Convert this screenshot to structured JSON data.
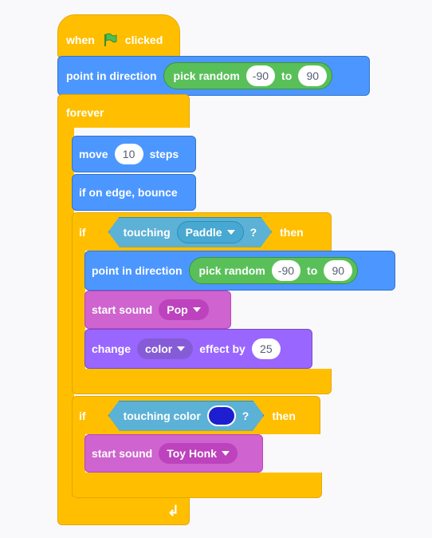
{
  "colors": {
    "control": "#ffbf00",
    "motion": "#4c97ff",
    "operators": "#59c059",
    "sensing": "#5cb1d6",
    "sound": "#cf63cf",
    "looks": "#9966ff",
    "touch_color_swatch": "#1d1ecf",
    "workspace": "#f9f9fb"
  },
  "hat": {
    "when": "when",
    "clicked": "clicked",
    "icon": "green-flag-icon"
  },
  "point_direction_1": {
    "label": "point in direction",
    "random": "pick random",
    "from": "-90",
    "to_label": "to",
    "to": "90"
  },
  "forever": {
    "label": "forever",
    "icon": "loop-arrow-icon"
  },
  "move": {
    "label": "move",
    "value": "10",
    "suffix": "steps"
  },
  "bounce": {
    "label": "if on edge, bounce"
  },
  "if1": {
    "if_label": "if",
    "touching": "touching",
    "target": "Paddle",
    "question": "?",
    "then_label": "then",
    "point_direction": {
      "label": "point in direction",
      "random": "pick random",
      "from": "-90",
      "to_label": "to",
      "to": "90"
    },
    "sound": {
      "label": "start sound",
      "value": "Pop"
    },
    "effect": {
      "label": "change",
      "effect": "color",
      "by_label": "effect by",
      "value": "25"
    }
  },
  "if2": {
    "if_label": "if",
    "touching_color": "touching color",
    "question": "?",
    "then_label": "then",
    "sound": {
      "label": "start sound",
      "value": "Toy Honk"
    }
  }
}
